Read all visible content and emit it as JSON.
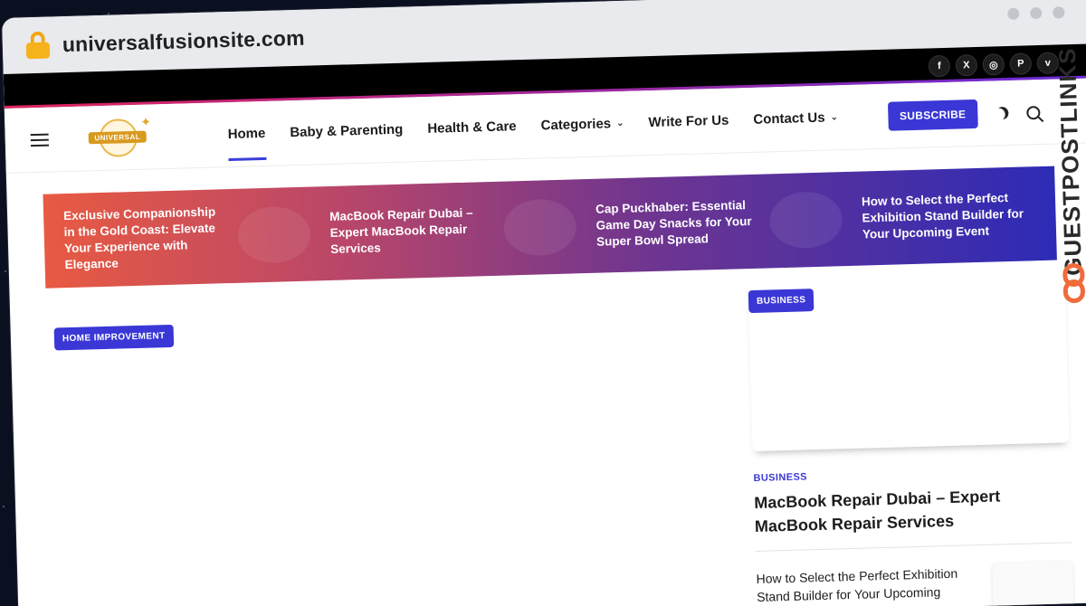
{
  "browser": {
    "url": "universalfusionsite.com"
  },
  "social": [
    "f",
    "X",
    "◎",
    "P",
    "v"
  ],
  "logo": {
    "text": "UNIVERSAL"
  },
  "nav": {
    "items": [
      {
        "label": "Home"
      },
      {
        "label": "Baby & Parenting"
      },
      {
        "label": "Health & Care"
      },
      {
        "label": "Categories"
      },
      {
        "label": "Write For Us"
      },
      {
        "label": "Contact Us"
      }
    ],
    "subscribe_label": "SUBSCRIBE"
  },
  "ticker": [
    {
      "title": "Exclusive Companionship in the Gold Coast: Elevate Your Experience with Elegance"
    },
    {
      "title": "MacBook Repair Dubai – Expert MacBook Repair Services"
    },
    {
      "title": "Cap Puckhaber: Essential Game Day Snacks for Your Super Bowl Spread"
    },
    {
      "title": "How to Select the Perfect Exhibition Stand Builder for Your Upcoming Event"
    }
  ],
  "main": {
    "badge": "HOME IMPROVEMENT"
  },
  "sidebar": {
    "card_badge": "BUSINESS",
    "category": "BUSINESS",
    "title": "MacBook Repair Dubai – Expert MacBook Repair Services",
    "item_title": "How to Select the Perfect Exhibition Stand Builder for Your Upcoming"
  },
  "watermark": {
    "text": "GUESTPOSTLINKS"
  }
}
